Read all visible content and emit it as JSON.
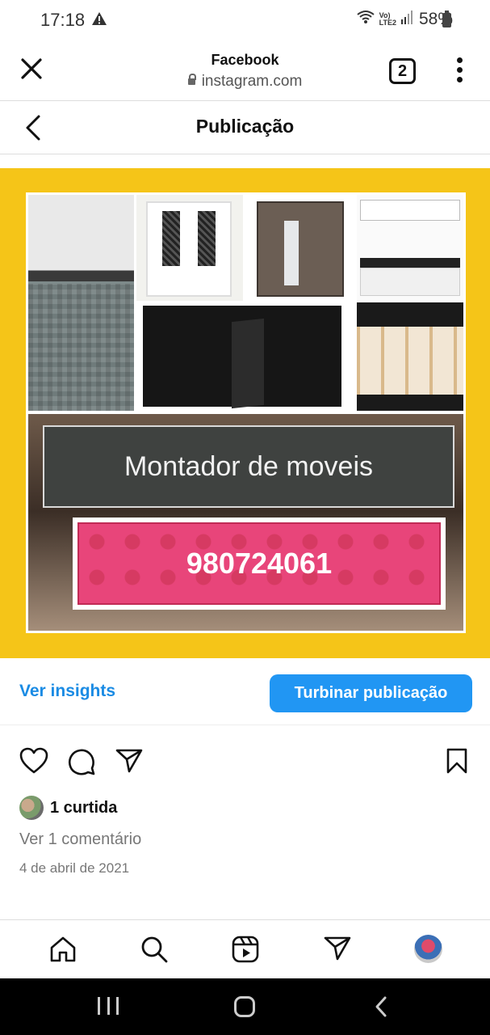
{
  "status_bar": {
    "time": "17:18",
    "battery": "58%"
  },
  "browser_bar": {
    "title": "Facebook",
    "url": "instagram.com",
    "tab_count": "2"
  },
  "post_header": {
    "title": "Publicação"
  },
  "post_image": {
    "banner_text": "Montador de moveis",
    "phone_text": "980724061",
    "background_color": "#f5c518"
  },
  "actions": {
    "insights_label": "Ver insights",
    "boost_label": "Turbinar publicação",
    "accent_color": "#2196f3"
  },
  "engagement": {
    "likes": "1 curtida",
    "comments": "Ver 1 comentário",
    "date": "4 de abril de 2021"
  },
  "icons": [
    "warning-icon",
    "close-icon",
    "menu-icon",
    "back-icon",
    "heart-icon",
    "comment-icon",
    "share-icon",
    "bookmark-icon",
    "home-icon",
    "search-icon",
    "reels-icon",
    "direct-icon"
  ]
}
